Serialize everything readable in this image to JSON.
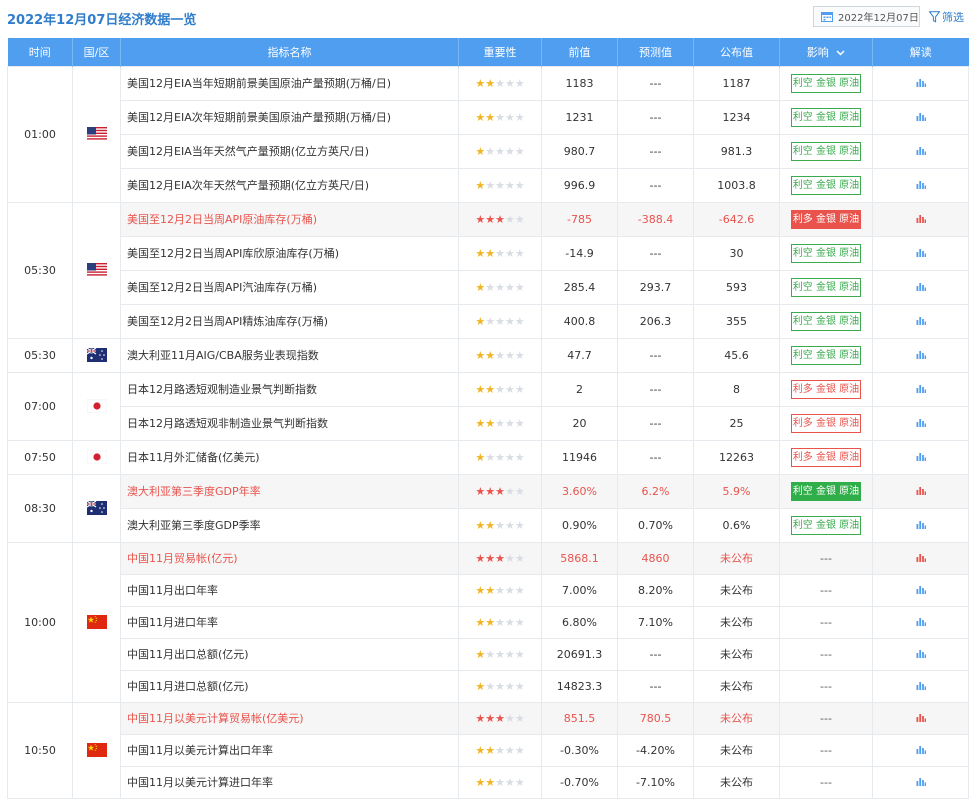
{
  "page": {
    "title": "2022年12月07日经济数据一览",
    "date": "2022年12月07日",
    "filter_label": "筛选"
  },
  "columns": {
    "time": "时间",
    "region": "国/区",
    "name": "指标名称",
    "importance": "重要性",
    "previous": "前值",
    "forecast": "预测值",
    "actual": "公布值",
    "impact": "影响",
    "read": "解读"
  },
  "colors": {
    "header_bg": "#4f9ef0",
    "title_blue": "#2f7dcb",
    "red": "#e9534c",
    "green": "#3cab4f",
    "star_gold": "#f0b522"
  },
  "groups": [
    {
      "time": "01:00",
      "flag": "us",
      "rows": [
        {
          "name": "美国12月EIA当年短期前景美国原油产量预期(万桶/日)",
          "stars": 2,
          "prev": "1183",
          "forecast": "---",
          "actual": "1187",
          "impact": "利空 金银 原油",
          "impact_style": "green-outline",
          "highlight": false
        },
        {
          "name": "美国12月EIA次年短期前景美国原油产量预期(万桶/日)",
          "stars": 2,
          "prev": "1231",
          "forecast": "---",
          "actual": "1234",
          "impact": "利空 金银 原油",
          "impact_style": "green-outline",
          "highlight": false
        },
        {
          "name": "美国12月EIA当年天然气产量预期(亿立方英尺/日)",
          "stars": 1,
          "prev": "980.7",
          "forecast": "---",
          "actual": "981.3",
          "impact": "利空 金银 原油",
          "impact_style": "green-outline",
          "highlight": false
        },
        {
          "name": "美国12月EIA次年天然气产量预期(亿立方英尺/日)",
          "stars": 1,
          "prev": "996.9",
          "forecast": "---",
          "actual": "1003.8",
          "impact": "利空 金银 原油",
          "impact_style": "green-outline",
          "highlight": false
        }
      ]
    },
    {
      "time": "05:30",
      "flag": "us",
      "rows": [
        {
          "name": "美国至12月2日当周API原油库存(万桶)",
          "stars": 3,
          "prev": "-785",
          "forecast": "-388.4",
          "actual": "-642.6",
          "impact": "利多 金银 原油",
          "impact_style": "red-fill",
          "highlight": true
        },
        {
          "name": "美国至12月2日当周API库欣原油库存(万桶)",
          "stars": 2,
          "prev": "-14.9",
          "forecast": "---",
          "actual": "30",
          "impact": "利空 金银 原油",
          "impact_style": "green-outline",
          "highlight": false
        },
        {
          "name": "美国至12月2日当周API汽油库存(万桶)",
          "stars": 1,
          "prev": "285.4",
          "forecast": "293.7",
          "actual": "593",
          "impact": "利空 金银 原油",
          "impact_style": "green-outline",
          "highlight": false
        },
        {
          "name": "美国至12月2日当周API精炼油库存(万桶)",
          "stars": 1,
          "prev": "400.8",
          "forecast": "206.3",
          "actual": "355",
          "impact": "利空 金银 原油",
          "impact_style": "green-outline",
          "highlight": false
        }
      ]
    },
    {
      "time": "05:30",
      "flag": "au",
      "rows": [
        {
          "name": "澳大利亚11月AIG/CBA服务业表现指数",
          "stars": 2,
          "prev": "47.7",
          "forecast": "---",
          "actual": "45.6",
          "impact": "利空 金银 原油",
          "impact_style": "green-outline",
          "highlight": false
        }
      ]
    },
    {
      "time": "07:00",
      "flag": "jp",
      "rows": [
        {
          "name": "日本12月路透短观制造业景气判断指数",
          "stars": 2,
          "prev": "2",
          "forecast": "---",
          "actual": "8",
          "impact": "利多 金银 原油",
          "impact_style": "red-outline",
          "highlight": false
        },
        {
          "name": "日本12月路透短观非制造业景气判断指数",
          "stars": 2,
          "prev": "20",
          "forecast": "---",
          "actual": "25",
          "impact": "利多 金银 原油",
          "impact_style": "red-outline",
          "highlight": false
        }
      ]
    },
    {
      "time": "07:50",
      "flag": "jp",
      "rows": [
        {
          "name": "日本11月外汇储备(亿美元)",
          "stars": 1,
          "prev": "11946",
          "forecast": "---",
          "actual": "12263",
          "impact": "利多 金银 原油",
          "impact_style": "red-outline",
          "highlight": false
        }
      ]
    },
    {
      "time": "08:30",
      "flag": "au",
      "rows": [
        {
          "name": "澳大利亚第三季度GDP年率",
          "stars": 3,
          "prev": "3.60%",
          "forecast": "6.2%",
          "actual": "5.9%",
          "impact": "利空 金银 原油",
          "impact_style": "green-fill",
          "highlight": true
        },
        {
          "name": "澳大利亚第三季度GDP季率",
          "stars": 2,
          "prev": "0.90%",
          "forecast": "0.70%",
          "actual": "0.6%",
          "impact": "利空 金银 原油",
          "impact_style": "green-outline",
          "highlight": false
        }
      ]
    },
    {
      "time": "10:00",
      "flag": "cn",
      "rows": [
        {
          "name": "中国11月贸易帐(亿元)",
          "stars": 3,
          "prev": "5868.1",
          "forecast": "4860",
          "actual": "未公布",
          "impact": "---",
          "impact_style": "none",
          "highlight": true
        },
        {
          "name": "中国11月出口年率",
          "stars": 2,
          "prev": "7.00%",
          "forecast": "8.20%",
          "actual": "未公布",
          "impact": "---",
          "impact_style": "none",
          "highlight": false
        },
        {
          "name": "中国11月进口年率",
          "stars": 2,
          "prev": "6.80%",
          "forecast": "7.10%",
          "actual": "未公布",
          "impact": "---",
          "impact_style": "none",
          "highlight": false
        },
        {
          "name": "中国11月出口总额(亿元)",
          "stars": 1,
          "prev": "20691.3",
          "forecast": "---",
          "actual": "未公布",
          "impact": "---",
          "impact_style": "none",
          "highlight": false
        },
        {
          "name": "中国11月进口总额(亿元)",
          "stars": 1,
          "prev": "14823.3",
          "forecast": "---",
          "actual": "未公布",
          "impact": "---",
          "impact_style": "none",
          "highlight": false
        }
      ]
    },
    {
      "time": "10:50",
      "flag": "cn",
      "rows": [
        {
          "name": "中国11月以美元计算贸易帐(亿美元)",
          "stars": 3,
          "prev": "851.5",
          "forecast": "780.5",
          "actual": "未公布",
          "impact": "---",
          "impact_style": "none",
          "highlight": true
        },
        {
          "name": "中国11月以美元计算出口年率",
          "stars": 2,
          "prev": "-0.30%",
          "forecast": "-4.20%",
          "actual": "未公布",
          "impact": "---",
          "impact_style": "none",
          "highlight": false
        },
        {
          "name": "中国11月以美元计算进口年率",
          "stars": 2,
          "prev": "-0.70%",
          "forecast": "-7.10%",
          "actual": "未公布",
          "impact": "---",
          "impact_style": "none",
          "highlight": false
        }
      ]
    }
  ]
}
